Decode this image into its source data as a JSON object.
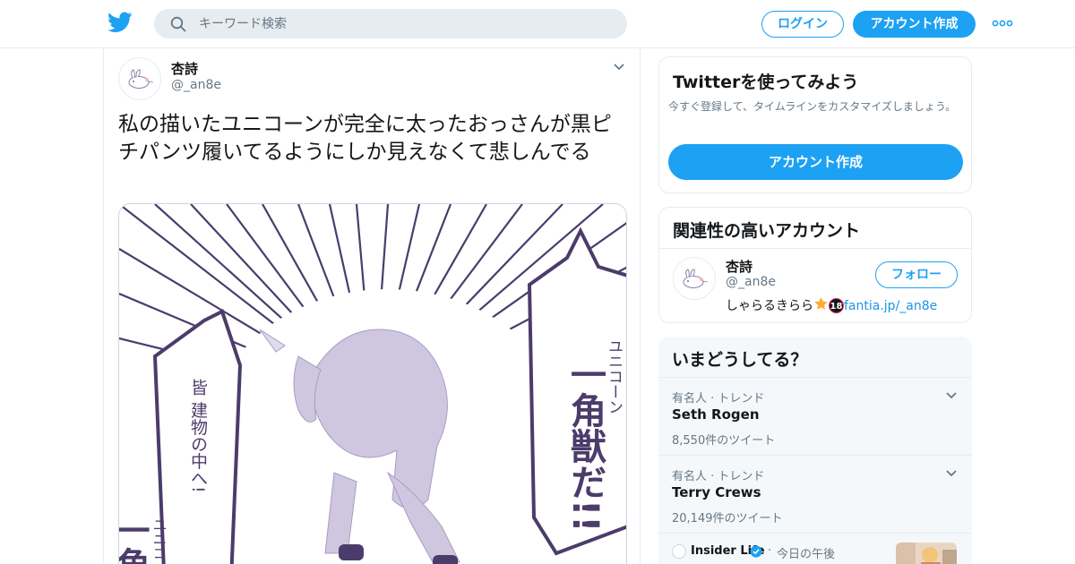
{
  "header": {
    "search_placeholder": "キーワード検索",
    "login_label": "ログイン",
    "signup_label": "アカウント作成"
  },
  "tweet": {
    "author_name": "杏詩",
    "author_handle": "@_an8e",
    "text": "私の描いたユニコーンが完全に太ったおっさんが黒ピチパンツ履いてるようにしか見えなくて悲しんでる",
    "image_text": {
      "bubble_right_large": "一角獣だ!!",
      "bubble_right_small": "ユニコーン",
      "bubble_left": "皆 建物の中へ!",
      "bubble_left_bottom_large": "一角",
      "bubble_left_bottom_small": "ユニコ"
    }
  },
  "signup_card": {
    "title": "Twitterを使ってみよう",
    "subtitle": "今すぐ登録して、タイムラインをカスタマイズしましょう。",
    "button_label": "アカウント作成"
  },
  "related_accounts": {
    "title": "関連性の高いアカウント",
    "items": [
      {
        "name": "杏詩",
        "handle": "@_an8e",
        "bio_text": "しゃらるきらら",
        "bio_badge": "18",
        "bio_link": "fantia.jp/_an8e",
        "follow_label": "フォロー"
      }
    ]
  },
  "trends": {
    "title": "いまどうしてる？",
    "items": [
      {
        "category": "有名人 · トレンド",
        "name": "Seth Rogen",
        "count": "8,550件のツイート"
      },
      {
        "category": "有名人 · トレンド",
        "name": "Terry Crews",
        "count": "20,149件のツイート"
      }
    ],
    "news": {
      "source": "Insider Life",
      "dot": "·",
      "time": "今日の午後"
    }
  },
  "colors": {
    "accent": "#1da1f2",
    "border": "#e6ecf0",
    "muted": "#657786",
    "illustration_ink": "#4b3c6b"
  },
  "icons": [
    "twitter-bird-icon",
    "search-icon",
    "more-dots-icon",
    "chevron-down-icon",
    "star-emoji-icon",
    "verified-badge-icon"
  ]
}
